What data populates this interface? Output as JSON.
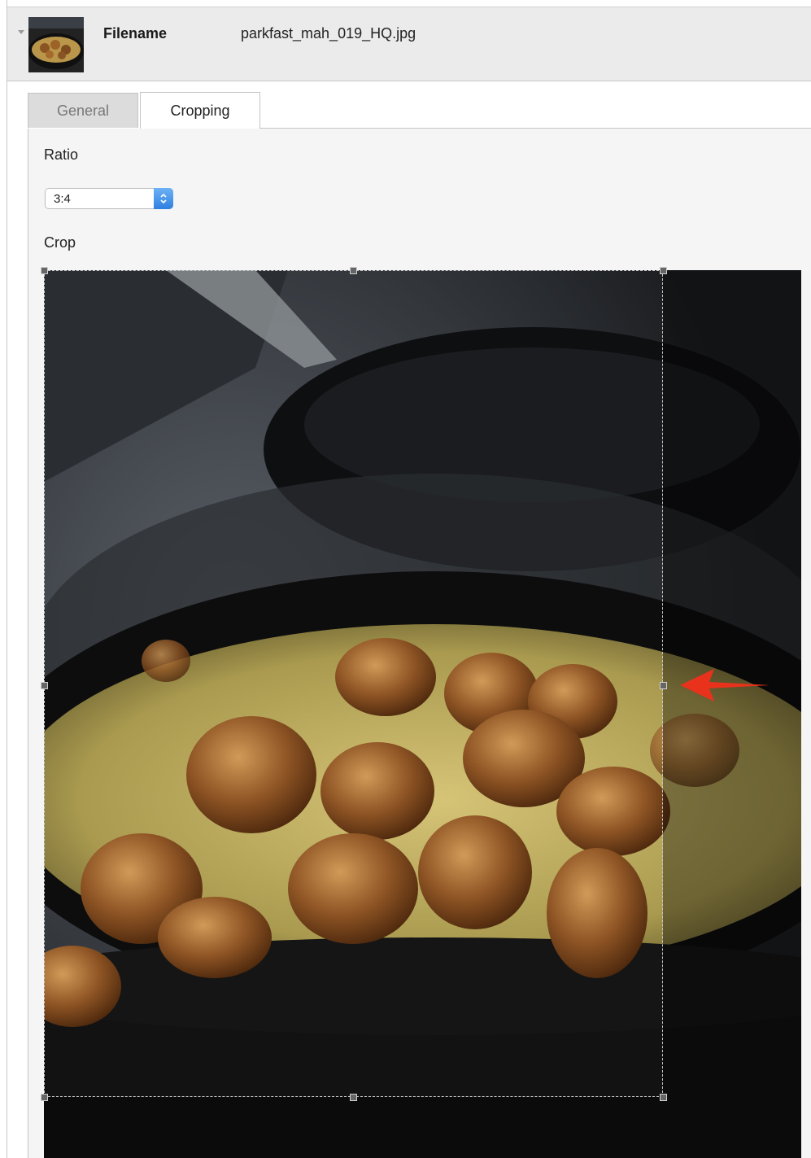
{
  "header": {
    "filename_label": "Filename",
    "filename_value": "parkfast_mah_019_HQ.jpg"
  },
  "tabs": [
    {
      "label": "General",
      "active": false
    },
    {
      "label": "Cropping",
      "active": true
    }
  ],
  "form": {
    "ratio_label": "Ratio",
    "ratio_value": "3:4",
    "crop_label": "Crop"
  },
  "icons": {
    "collapse": "caret-down-icon",
    "select_arrows": "chevron-up-down-icon",
    "annotation": "red-arrow-left-icon"
  },
  "colors": {
    "select_accent": "#3a8ae8",
    "annotation": "#e8321c",
    "header_bg": "#ebebeb",
    "content_bg": "#f5f5f5"
  }
}
